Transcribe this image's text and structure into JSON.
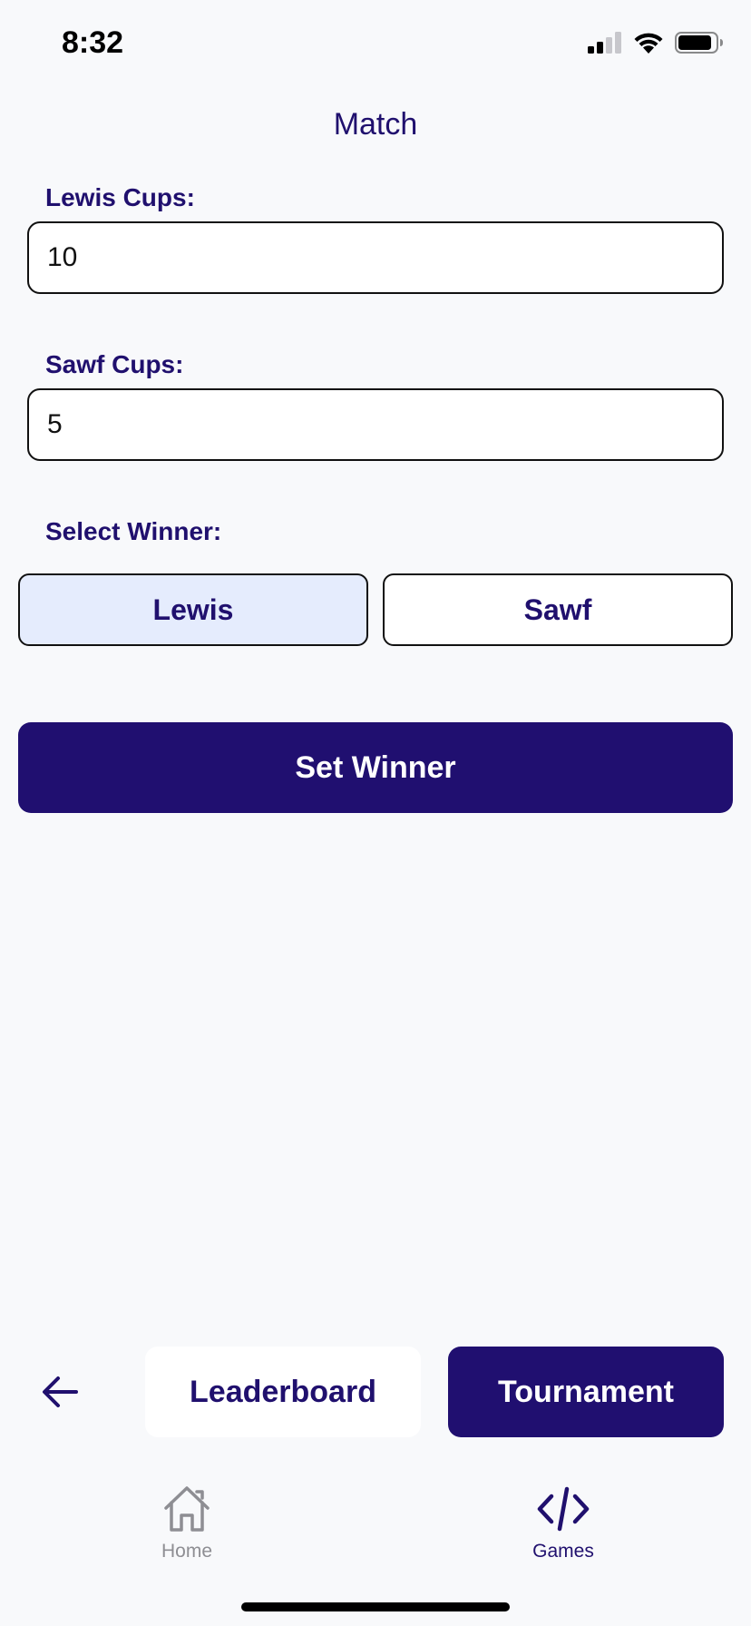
{
  "status_bar": {
    "time": "8:32",
    "icons": [
      "cellular-signal-icon",
      "wifi-icon",
      "battery-icon"
    ]
  },
  "screen": {
    "title": "Match"
  },
  "lewis_cups": {
    "label": "Lewis Cups:",
    "value": "10"
  },
  "sawf_cups": {
    "label": "Sawf Cups:",
    "value": "5"
  },
  "winner": {
    "label": "Select Winner:",
    "options": [
      "Lewis",
      "Sawf"
    ],
    "selected": "Lewis"
  },
  "set_winner_label": "Set Winner",
  "footer": {
    "back_icon": "arrow-left-icon",
    "leaderboard_label": "Leaderboard",
    "tournament_label": "Tournament"
  },
  "tab_bar": {
    "items": [
      {
        "label": "Home",
        "icon": "home-icon",
        "active": false
      },
      {
        "label": "Games",
        "icon": "code-icon",
        "active": true
      }
    ]
  },
  "colors": {
    "primary": "#200f70",
    "selected_bg": "#e5ecfd",
    "background": "#f8f9fb",
    "inactive_tab": "#8e8e93"
  }
}
